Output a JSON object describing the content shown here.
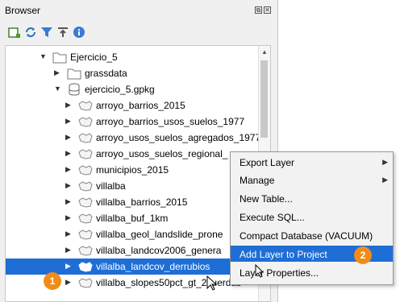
{
  "panel": {
    "title": "Browser",
    "dock_float": "⧉",
    "dock_close": "✕"
  },
  "tree": {
    "items": [
      {
        "label": "Ejercicio_5"
      },
      {
        "label": "grassdata"
      },
      {
        "label": "ejercicio_5.gpkg"
      },
      {
        "label": "arroyo_barrios_2015"
      },
      {
        "label": "arroyo_barrios_usos_suelos_1977"
      },
      {
        "label": "arroyo_usos_suelos_agregados_1977"
      },
      {
        "label": "arroyo_usos_suelos_regional_"
      },
      {
        "label": "municipios_2015"
      },
      {
        "label": "villalba"
      },
      {
        "label": "villalba_barrios_2015"
      },
      {
        "label": "villalba_buf_1km"
      },
      {
        "label": "villalba_geol_landslide_prone"
      },
      {
        "label": "villalba_landcov2006_genera"
      },
      {
        "label": "villalba_landcov_derrubios"
      },
      {
        "label": "villalba_slopes50pct_gt_2cuerdas"
      }
    ]
  },
  "context_menu": {
    "items": [
      {
        "label": "Export Layer"
      },
      {
        "label": "Manage"
      },
      {
        "label": "New Table..."
      },
      {
        "label": "Execute SQL..."
      },
      {
        "label": "Compact Database (VACUUM)"
      },
      {
        "label": "Add Layer to Project"
      },
      {
        "label": "Layer Properties..."
      }
    ]
  },
  "badges": {
    "one": "1",
    "two": "2"
  },
  "colors": {
    "selection": "#1e6ed6",
    "badge": "#f28c18"
  }
}
